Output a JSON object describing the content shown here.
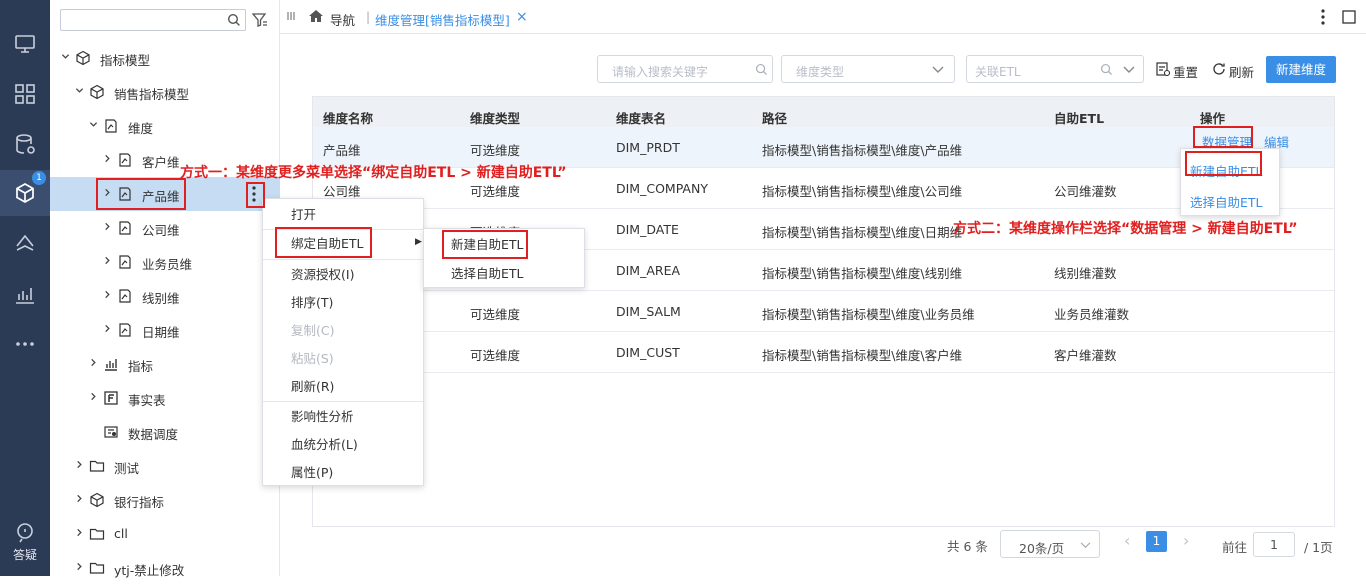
{
  "rail": {
    "badge": "1",
    "help_label": "答疑",
    "icons": [
      "monitor-icon",
      "grid-apps-icon",
      "database-icon",
      "cube-model-icon",
      "layers-icon",
      "chart-icon",
      "more-icon",
      "help-icon"
    ]
  },
  "tree": {
    "search_placeholder": "",
    "items": [
      {
        "label": "指标模型",
        "icon": "cube-icon"
      },
      {
        "label": "销售指标模型",
        "icon": "cube-icon"
      },
      {
        "label": "维度",
        "icon": "dimension-icon"
      },
      {
        "label": "客户维",
        "icon": "dimension-icon"
      },
      {
        "label": "产品维",
        "icon": "dimension-icon"
      },
      {
        "label": "公司维",
        "icon": "dimension-icon"
      },
      {
        "label": "业务员维",
        "icon": "dimension-icon"
      },
      {
        "label": "线别维",
        "icon": "dimension-icon"
      },
      {
        "label": "日期维",
        "icon": "dimension-icon"
      },
      {
        "label": "指标",
        "icon": "bar-chart-icon"
      },
      {
        "label": "事实表",
        "icon": "fact-table-icon"
      },
      {
        "label": "数据调度",
        "icon": "schedule-icon"
      },
      {
        "label": "测试",
        "icon": "folder-icon"
      },
      {
        "label": "银行指标",
        "icon": "cube-icon"
      },
      {
        "label": "cll",
        "icon": "folder-icon"
      },
      {
        "label": "ytj-禁止修改",
        "icon": "folder-icon"
      }
    ]
  },
  "topbar": {
    "nav_label": "导航",
    "tab_label": "维度管理[销售指标模型]",
    "close_glyph": "×"
  },
  "toolbar": {
    "search_placeholder": "请输入搜索关键字",
    "dim_type_placeholder": "维度类型",
    "etl_placeholder": "关联ETL",
    "reset_label": "重置",
    "refresh_label": "刷新",
    "new_label": "新建维度"
  },
  "table": {
    "headers": [
      "维度名称",
      "维度类型",
      "维度表名",
      "路径",
      "自助ETL",
      "操作"
    ],
    "rows": [
      {
        "name": "产品维",
        "type": "可选维度",
        "table": "DIM_PRDT",
        "path": "指标模型\\销售指标模型\\维度\\产品维",
        "etl": "",
        "op1": "数据管理",
        "op2": "编辑"
      },
      {
        "name": "公司维",
        "type": "可选维度",
        "table": "DIM_COMPANY",
        "path": "指标模型\\销售指标模型\\维度\\公司维",
        "etl": "公司维灌数",
        "op1": "",
        "op2": ""
      },
      {
        "name": "",
        "type": "可选维度",
        "table": "DIM_DATE",
        "path": "指标模型\\销售指标模型\\维度\\日期维",
        "etl": "",
        "op1": "",
        "op2": ""
      },
      {
        "name": "",
        "type": "",
        "table": "DIM_AREA",
        "path": "指标模型\\销售指标模型\\维度\\线别维",
        "etl": "线别维灌数",
        "op1": "",
        "op2": ""
      },
      {
        "name": "",
        "type": "可选维度",
        "table": "DIM_SALM",
        "path": "指标模型\\销售指标模型\\维度\\业务员维",
        "etl": "业务员维灌数",
        "op1": "",
        "op2": ""
      },
      {
        "name": "",
        "type": "可选维度",
        "table": "DIM_CUST",
        "path": "指标模型\\销售指标模型\\维度\\客户维",
        "etl": "客户维灌数",
        "op1": "",
        "op2": ""
      }
    ]
  },
  "context_menu": {
    "items": [
      "打开",
      "绑定自助ETL",
      "资源授权(I)",
      "排序(T)",
      "复制(C)",
      "粘贴(S)",
      "刷新(R)",
      "影响性分析",
      "血统分析(L)",
      "属性(P)"
    ]
  },
  "submenu": {
    "items": [
      "新建自助ETL",
      "选择自助ETL"
    ]
  },
  "op_dropdown": {
    "items": [
      "新建自助ETL",
      "选择自助ETL"
    ]
  },
  "annotations": {
    "one": "方式一：某维度更多菜单选择“绑定自助ETL > 新建自助ETL”",
    "two": "方式二：某维度操作栏选择“数据管理 >  新建自助ETL”"
  },
  "pagination": {
    "total": "共 6 条",
    "page_size": "20条/页",
    "prev": "‹",
    "current": "1",
    "next": "›",
    "goto_label": "前往",
    "goto_value": "1",
    "pages": "/ 1页"
  },
  "colors": {
    "rail_bg": "#2b3a55",
    "primary": "#3a8ee6",
    "annotation_red": "#e02020",
    "selected_row": "#c5dcf2"
  }
}
